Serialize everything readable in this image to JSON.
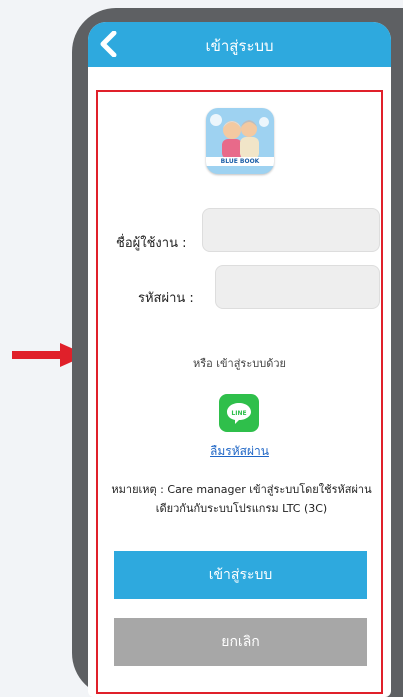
{
  "header": {
    "title": "เข้าสู่ระบบ",
    "back_icon": "chevron-left-icon"
  },
  "logo": {
    "caption": "BLUE BOOK"
  },
  "form": {
    "username_label": "ชื่อผู้ใช้งาน :",
    "password_label": "รหัสผ่าน :",
    "username_value": "",
    "password_value": ""
  },
  "alt_login": {
    "text": "หรือ เข้าสู่ระบบด้วย",
    "line_label": "LINE"
  },
  "forgot_password": "ลืมรหัสผ่าน",
  "note": "หมายเหตุ : Care manager เข้าสู่ระบบโดยใช้รหัสผ่านเดียวกันกับระบบโปรแกรม LTC (3C)",
  "buttons": {
    "login": "เข้าสู่ระบบ",
    "cancel": "ยกเลิก"
  },
  "colors": {
    "accent": "#2ea9de",
    "highlight": "#e0202a",
    "line_green": "#2fbf4b",
    "cancel_grey": "#a7a7a7"
  }
}
